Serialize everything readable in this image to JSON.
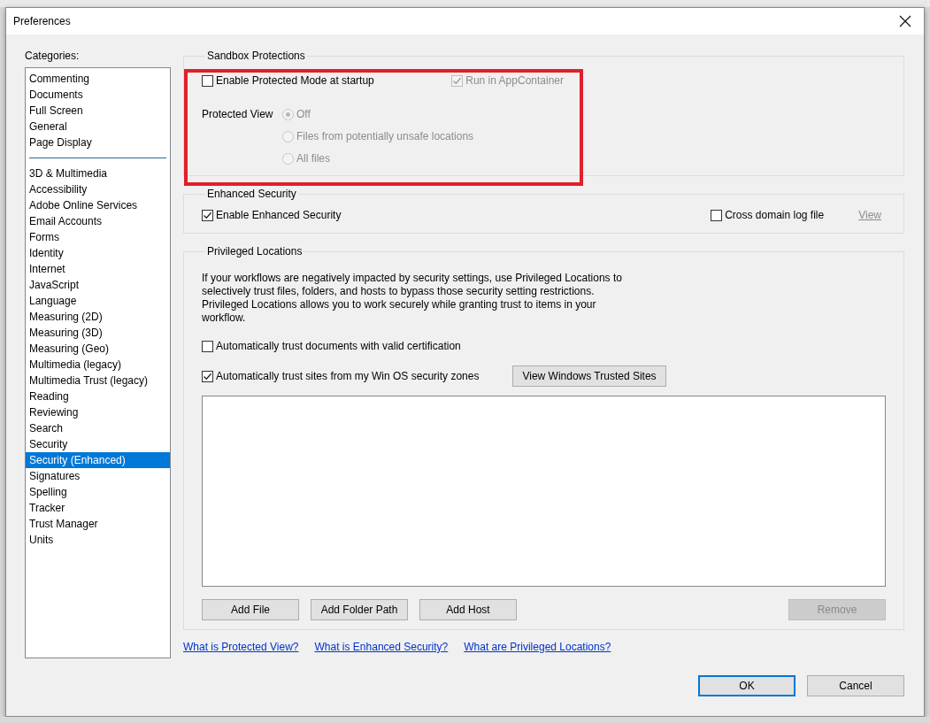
{
  "window": {
    "title": "Preferences"
  },
  "categories": {
    "label": "Categories:",
    "groups": [
      [
        {
          "label": "Commenting",
          "selected": false
        },
        {
          "label": "Documents",
          "selected": false
        },
        {
          "label": "Full Screen",
          "selected": false
        },
        {
          "label": "General",
          "selected": false
        },
        {
          "label": "Page Display",
          "selected": false
        }
      ],
      [
        {
          "label": "3D & Multimedia",
          "selected": false
        },
        {
          "label": "Accessibility",
          "selected": false
        },
        {
          "label": "Adobe Online Services",
          "selected": false
        },
        {
          "label": "Email Accounts",
          "selected": false
        },
        {
          "label": "Forms",
          "selected": false
        },
        {
          "label": "Identity",
          "selected": false
        },
        {
          "label": "Internet",
          "selected": false
        },
        {
          "label": "JavaScript",
          "selected": false
        },
        {
          "label": "Language",
          "selected": false
        },
        {
          "label": "Measuring (2D)",
          "selected": false
        },
        {
          "label": "Measuring (3D)",
          "selected": false
        },
        {
          "label": "Measuring (Geo)",
          "selected": false
        },
        {
          "label": "Multimedia (legacy)",
          "selected": false
        },
        {
          "label": "Multimedia Trust (legacy)",
          "selected": false
        },
        {
          "label": "Reading",
          "selected": false
        },
        {
          "label": "Reviewing",
          "selected": false
        },
        {
          "label": "Search",
          "selected": false
        },
        {
          "label": "Security",
          "selected": false
        },
        {
          "label": "Security (Enhanced)",
          "selected": true
        },
        {
          "label": "Signatures",
          "selected": false
        },
        {
          "label": "Spelling",
          "selected": false
        },
        {
          "label": "Tracker",
          "selected": false
        },
        {
          "label": "Trust Manager",
          "selected": false
        },
        {
          "label": "Units",
          "selected": false
        }
      ]
    ]
  },
  "sandbox": {
    "title": "Sandbox Protections",
    "highlighted": true,
    "protected_mode": {
      "label": "Enable Protected Mode at startup",
      "checked": false,
      "disabled": false
    },
    "app_container": {
      "label": "Run in AppContainer",
      "checked": true,
      "disabled": true
    },
    "protected_view": {
      "label": "Protected View",
      "options": [
        {
          "label": "Off",
          "selected": true,
          "disabled": true
        },
        {
          "label": "Files from potentially unsafe locations",
          "selected": false,
          "disabled": true
        },
        {
          "label": "All files",
          "selected": false,
          "disabled": true
        }
      ]
    }
  },
  "enhanced": {
    "title": "Enhanced Security",
    "enable": {
      "label": "Enable Enhanced Security",
      "checked": true,
      "disabled": false
    },
    "cross_domain": {
      "label": "Cross domain log file",
      "checked": false,
      "disabled": false
    },
    "view_link": {
      "label": "View",
      "disabled": true
    }
  },
  "privileged": {
    "title": "Privileged Locations",
    "description": "If your workflows are negatively impacted by security settings, use Privileged Locations to selectively trust files, folders, and hosts to bypass those security setting restrictions. Privileged Locations allows you to work securely while granting trust to items in your workflow.",
    "options": [
      {
        "label": "Automatically trust documents with valid certification",
        "checked": false,
        "disabled": false
      },
      {
        "label": "Automatically trust sites from my Win OS security zones",
        "checked": true,
        "disabled": false
      }
    ],
    "trusted_sites_button": "View Windows Trusted Sites",
    "buttons": [
      {
        "label": "Add File",
        "disabled": false
      },
      {
        "label": "Add Folder Path",
        "disabled": false
      },
      {
        "label": "Add Host",
        "disabled": false
      },
      {
        "label": "Remove",
        "disabled": true
      }
    ]
  },
  "help_links": [
    "What is Protected View?",
    "What is Enhanced Security?",
    "What are Privileged Locations?"
  ],
  "dialog_buttons": [
    {
      "label": "OK",
      "default": true
    },
    {
      "label": "Cancel",
      "default": false
    }
  ]
}
